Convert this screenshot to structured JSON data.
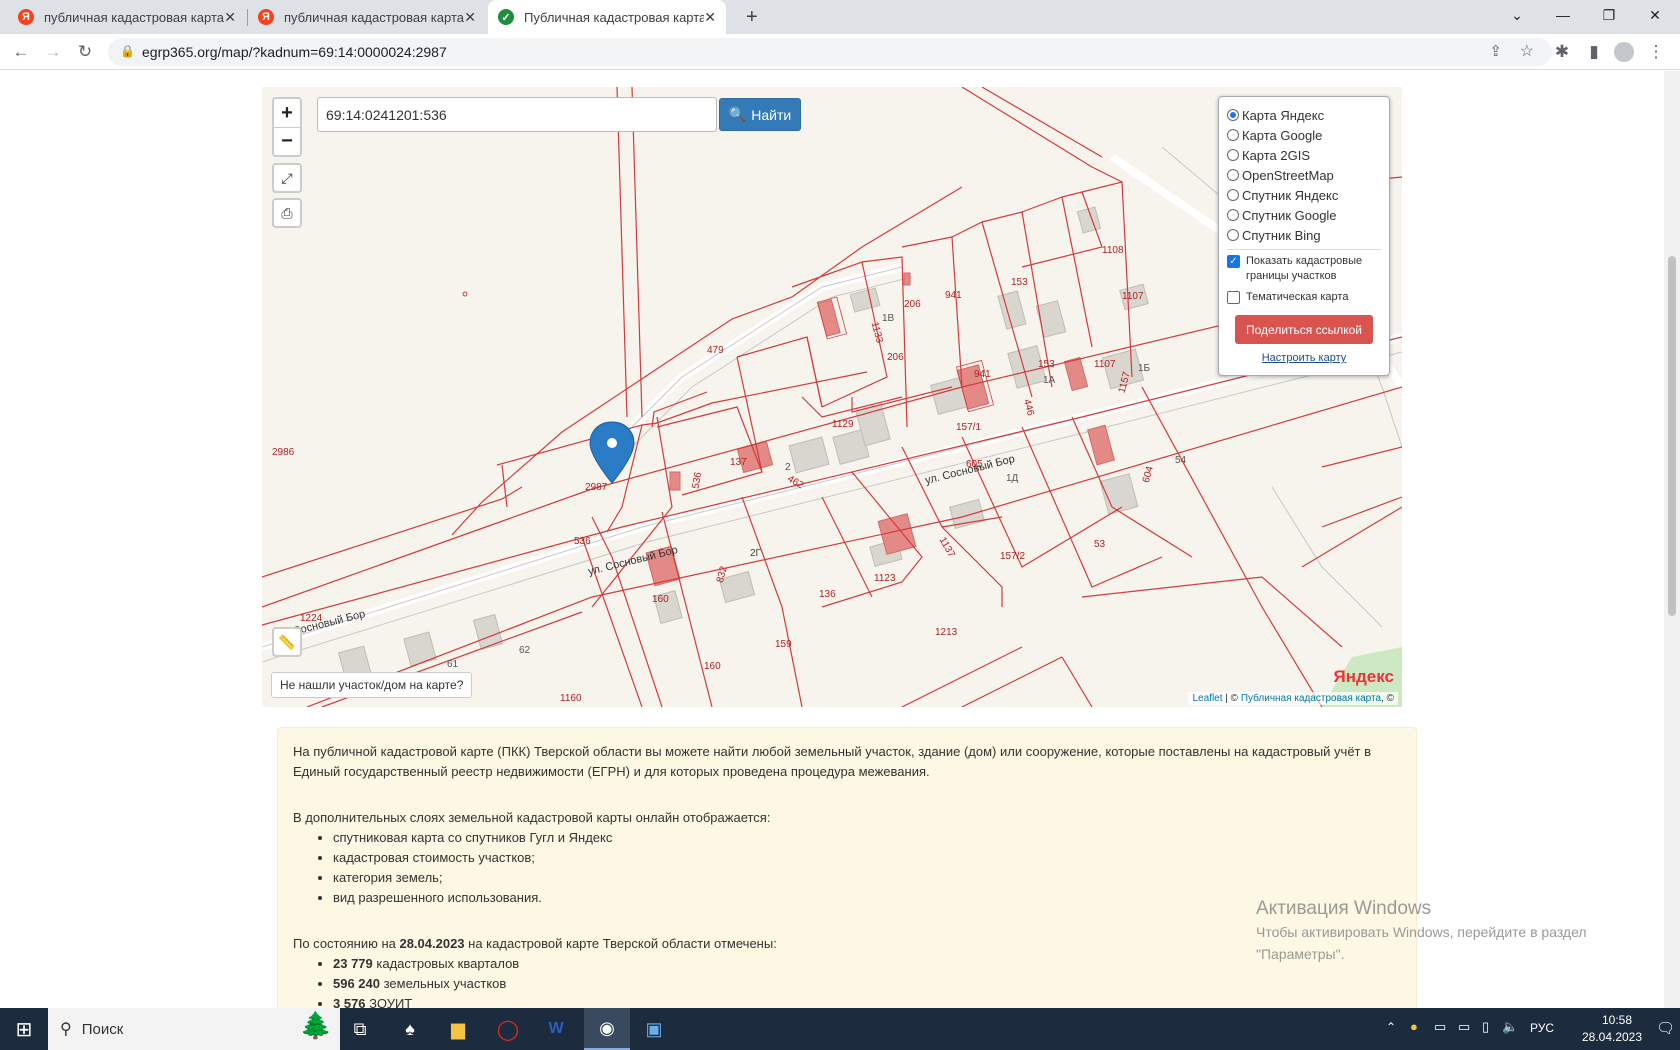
{
  "browser": {
    "tabs": [
      {
        "title": "публичная кадастровая карта тве",
        "favicon": "yandex-icon",
        "active": false
      },
      {
        "title": "публичная кадастровая карта тве",
        "favicon": "yandex-icon",
        "active": false
      },
      {
        "title": "Публичная кадастровая карта Тве",
        "favicon": "check-icon",
        "active": true
      }
    ],
    "url": "egrp365.org/map/?kadnum=69:14:0000024:2987"
  },
  "map": {
    "search_value": "69:14:0241201:536",
    "find_label": "Найти",
    "zoom_in": "+",
    "zoom_out": "−",
    "layers": [
      {
        "label": "Карта Яндекс",
        "selected": true
      },
      {
        "label": "Карта Google",
        "selected": false
      },
      {
        "label": "Карта 2GIS",
        "selected": false
      },
      {
        "label": "OpenStreetMap",
        "selected": false
      },
      {
        "label": "Спутник Яндекс",
        "selected": false
      },
      {
        "label": "Спутник Google",
        "selected": false
      },
      {
        "label": "Спутник Bing",
        "selected": false
      }
    ],
    "show_borders_label": "Показать кадастровые границы участков",
    "show_borders_checked": true,
    "thematic_label": "Тематическая карта",
    "thematic_checked": false,
    "share_label": "Поделиться ссылкой",
    "configure_label": "Настроить карту",
    "not_found_label": "Не нашли участок/дом на карте?",
    "attribution_leaflet": "Leaflet",
    "attribution_sep": " | © ",
    "attribution_pkk": "Публичная кадастровая карта",
    "attribution_tail": ", ©",
    "yandex_logo": "Яндекс",
    "parcel_labels": [
      "2986",
      "479",
      "2987",
      "536",
      "536",
      "137",
      "1129",
      "206",
      "206",
      "941",
      "941",
      "153",
      "153",
      "1108",
      "1107",
      "1107",
      "157/1",
      "1224",
      "160",
      "160",
      "2Г",
      "136",
      "1123",
      "1213",
      "159",
      "157/2",
      "53",
      "54",
      "1160",
      "62",
      "61",
      "1В",
      "1Б",
      "1А",
      "1Д",
      "2",
      "1133",
      "1157",
      "446",
      "604",
      "605",
      "462",
      "1137",
      "832"
    ],
    "street_labels": [
      "ул. Сосновый Бор",
      "ул. Сосновый Бор",
      "Сосновый Бор"
    ]
  },
  "info": {
    "para1": "На публичной кадастровой карте (ПКК) Тверской области вы можете найти любой земельный участок, здание (дом) или сооружение, которые поставлены на кадастровый учёт в Единый государственный реестр недвижимости (ЕГРН) и для которых проведена процедура межевания.",
    "layers_intro": "В дополнительных слоях земельной кадастровой карты онлайн отображается:",
    "layers_list": [
      "спутниковая карта со спутников Гугл и Яндекс",
      "кадастровая стоимость участков;",
      "категория земель;",
      "вид разрешенного использования."
    ],
    "status_prefix": "По состоянию на ",
    "status_date": "28.04.2023",
    "status_suffix": " на кадастровой карте Тверской области отмечены:",
    "stats": [
      {
        "value": "23 779",
        "label": " кадастровых кварталов"
      },
      {
        "value": "596 240",
        "label": " земельных участков"
      },
      {
        "value": "3 576",
        "label": " ЗОУИТ"
      }
    ]
  },
  "watermark": {
    "title": "Активация Windows",
    "line1": "Чтобы активировать Windows, перейдите в раздел",
    "line2": "\"Параметры\"."
  },
  "taskbar": {
    "search_placeholder": "Поиск",
    "lang": "РУС",
    "time": "10:58",
    "date": "28.04.2023"
  }
}
